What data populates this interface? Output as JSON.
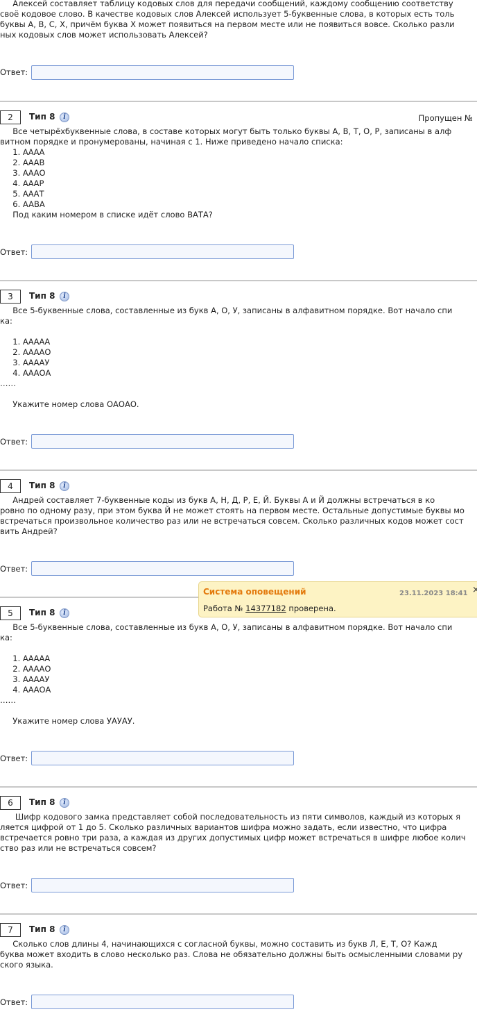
{
  "answer_label": "Ответ:",
  "type_label": "Тип 8",
  "info_icon_glyph": "i",
  "problem1": {
    "lines": [
      "     Алексей составляет таблицу кодовых слов для передачи сообщений, каждому сообщению соответству",
      "своё кодовое слово. В качестве кодовых слов Алексей использует 5-буквенные слова, в которых есть толь",
      "буквы A, B, C, X, причём буква X может появиться на первом месте или не появиться вовсе. Сколько разли",
      "ных кодовых слов может использовать Алексей?"
    ]
  },
  "problem2": {
    "number": "2",
    "skipped": "Пропущен №",
    "lines": [
      "     Все четырёхбуквенные слова, в составе которых могут быть только буквы А, В, Т, О, Р, записаны в алф",
      "витном порядке и пронумерованы, начиная с 1. Ниже приведено начало списка:",
      "     1. АААА",
      "     2. АААВ",
      "     3. АААО",
      "     4. АААР",
      "     5. АААТ",
      "     6. AABA",
      "     Под каким номером в списке идёт слово ВАТА?"
    ]
  },
  "problem3": {
    "number": "3",
    "lines": [
      "     Все 5-буквенные слова, составленные из букв А, О, У, записаны в алфавитном порядке. Вот начало спи",
      "ка:",
      "",
      "     1. ААААА",
      "     2. ААААО",
      "     3. ААААУ",
      "     4. АААОА",
      "……",
      "",
      "     Укажите номер слова ОАОАО."
    ]
  },
  "problem4": {
    "number": "4",
    "lines": [
      "     Андрей составляет 7-буквенные коды из букв А, Н, Д, Р, Е, Й. Буквы А и Й должны встречаться в ко",
      "ровно по одному разу, при этом буква Й не может стоять на первом месте. Остальные допустимые буквы мо",
      "встречаться произвольное количество раз или не встречаться совсем. Сколько различных кодов может сост",
      "вить Андрей?"
    ]
  },
  "problem5": {
    "number": "5",
    "lines": [
      "     Все 5-буквенные слова, составленные из букв А, О, У, записаны в алфавитном порядке. Вот начало спи",
      "ка:",
      "",
      "     1. ААААА",
      "     2. ААААО",
      "     3. ААААУ",
      "     4. АААОА",
      "……",
      "",
      "     Укажите номер слова УАУАУ."
    ]
  },
  "problem6": {
    "number": "6",
    "lines": [
      "      Шифр кодового замка представляет собой последовательность из пяти символов, каждый из которых я",
      "ляется цифрой от 1 до 5. Сколько различных вариантов шифра можно задать, если известно, что цифра",
      "встречается ровно три раза, а каждая из других допустимых цифр может встречаться в шифре любое колич",
      "ство раз или не встречаться совсем?"
    ]
  },
  "problem7": {
    "number": "7",
    "lines": [
      "     Сколько слов длины 4, начинающихся с согласной буквы, можно составить из букв Л, Е, Т, О? Кажд",
      "буква может входить в слово несколько раз. Слова не обязательно должны быть осмысленными словами ру",
      "ского языка."
    ]
  },
  "notification": {
    "title": "Система оповещений",
    "date": "23.11.2023 18:41",
    "close_glyph": "×",
    "body_prefix": "Работа № ",
    "work_number": "14377182",
    "body_suffix": " проверена."
  }
}
